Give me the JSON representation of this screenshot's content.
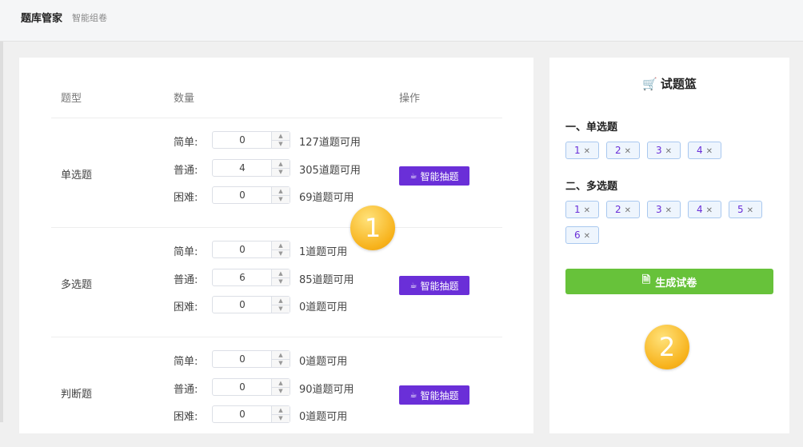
{
  "header": {
    "title": "题库管家",
    "subtitle": "智能组卷"
  },
  "table": {
    "col_type": "题型",
    "col_count": "数量",
    "col_action": "操作",
    "rows": [
      {
        "type": "单选题",
        "lines": [
          {
            "label": "简单:",
            "value": "0",
            "available": "127道题可用"
          },
          {
            "label": "普通:",
            "value": "4",
            "available": "305道题可用"
          },
          {
            "label": "困难:",
            "value": "0",
            "available": "69道题可用"
          }
        ],
        "button": "智能抽题"
      },
      {
        "type": "多选题",
        "lines": [
          {
            "label": "简单:",
            "value": "0",
            "available": "1道题可用"
          },
          {
            "label": "普通:",
            "value": "6",
            "available": "85道题可用"
          },
          {
            "label": "困难:",
            "value": "0",
            "available": "0道题可用"
          }
        ],
        "button": "智能抽题"
      },
      {
        "type": "判断题",
        "lines": [
          {
            "label": "简单:",
            "value": "0",
            "available": "0道题可用"
          },
          {
            "label": "普通:",
            "value": "0",
            "available": "90道题可用"
          },
          {
            "label": "困难:",
            "value": "0",
            "available": "0道题可用"
          }
        ],
        "button": "智能抽题"
      }
    ]
  },
  "basket": {
    "title": "试题篮",
    "sections": [
      {
        "title": "一、单选题",
        "items": [
          "1",
          "2",
          "3",
          "4"
        ]
      },
      {
        "title": "二、多选题",
        "items": [
          "1",
          "2",
          "3",
          "4",
          "5",
          "6"
        ]
      }
    ],
    "generate_button": "生成试卷"
  },
  "markers": [
    "1",
    "2"
  ],
  "colors": {
    "primary_button": "#6a2fd8",
    "generate_button": "#67c23a",
    "marker": "#f7b21b"
  },
  "icons": {
    "cart": "cart-icon",
    "cup": "cup-icon",
    "document": "document-icon",
    "close": "close-icon"
  }
}
